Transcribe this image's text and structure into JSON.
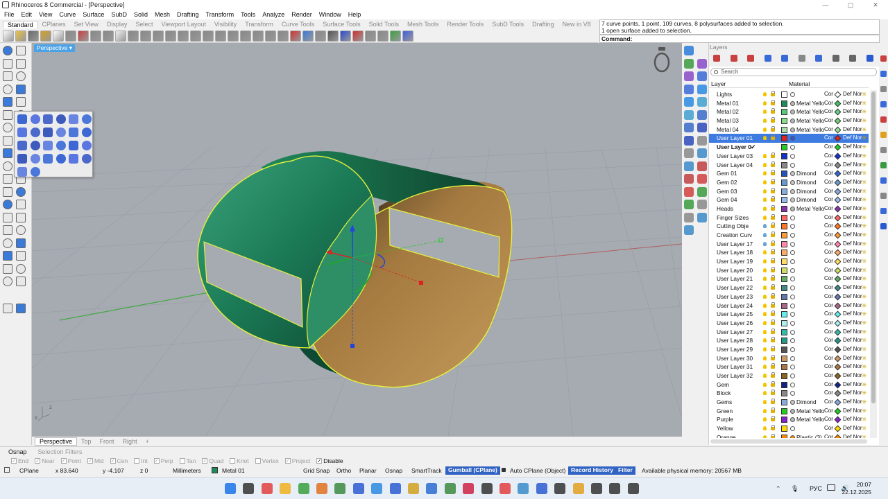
{
  "titlebar": {
    "title": "Rhinoceros 8 Commercial - [Perspective]",
    "min": "—",
    "max": "▢",
    "close": "✕"
  },
  "menu": [
    "File",
    "Edit",
    "View",
    "Curve",
    "Surface",
    "SubD",
    "Solid",
    "Mesh",
    "Drafting",
    "Transform",
    "Tools",
    "Analyze",
    "Render",
    "Window",
    "Help"
  ],
  "toolbar_tabs": [
    "Standard",
    "CPlanes",
    "Set View",
    "Display",
    "Select",
    "Viewport Layout",
    "Visibility",
    "Transform",
    "Curve Tools",
    "Surface Tools",
    "Solid Tools",
    "Mesh Tools",
    "Render Tools",
    "SubD Tools",
    "Drafting",
    "New in V8",
    "KeyShot"
  ],
  "command": {
    "history_line1": "7 curve points, 1 point, 109 curves, 8 polysurfaces added to selection.",
    "history_line2": "1 open surface added to selection.",
    "prompt": "Command:"
  },
  "viewport": {
    "title": "Perspective ▾",
    "axis_z": "z",
    "axis_x": "x"
  },
  "viewport_tabs": [
    "Perspective",
    "Top",
    "Front",
    "Right",
    "+"
  ],
  "panel": {
    "title": "Layers",
    "search_placeholder": "Search",
    "col_layer": "Layer",
    "col_material": "Material",
    "layers": [
      {
        "name": "Lights",
        "color": "#ffffff",
        "mat": "",
        "mc": "#ffffff",
        "dc": "#ffffff",
        "cur": false,
        "sel": false,
        "bulb": "on"
      },
      {
        "name": "Metal 01",
        "color": "#1e8c5a",
        "mat": "Metal Yello",
        "mc": "#b8b8b8",
        "dc": "#44c060",
        "cur": false,
        "sel": false,
        "bulb": "on"
      },
      {
        "name": "Metal 02",
        "color": "#5ac878",
        "mat": "Metal Yello",
        "mc": "#b8b8b8",
        "dc": "#66cc88",
        "cur": false,
        "sel": false,
        "bulb": "on"
      },
      {
        "name": "Metal 03",
        "color": "#88dd88",
        "mat": "Metal Yello",
        "mc": "#b8b8b8",
        "dc": "#77cc77",
        "cur": false,
        "sel": false,
        "bulb": "on"
      },
      {
        "name": "Metal 04",
        "color": "#aaddaa",
        "mat": "Metal Yello",
        "mc": "#b8b8b8",
        "dc": "#99dd99",
        "cur": false,
        "sel": false,
        "bulb": "on"
      },
      {
        "name": "User Layer 01",
        "color": "#dd2222",
        "mat": "",
        "mc": "#3355dd",
        "dc": "#dd2222",
        "cur": false,
        "sel": true,
        "bulb": "on"
      },
      {
        "name": "User Layer 0",
        "color": "#22cc22",
        "mat": "",
        "mc": "#ffffff",
        "dc": "#22cc22",
        "cur": true,
        "sel": false,
        "bulb": "on"
      },
      {
        "name": "User Layer 03",
        "color": "#1133cc",
        "mat": "",
        "mc": "#ffffff",
        "dc": "#1133cc",
        "cur": false,
        "sel": false,
        "bulb": "on"
      },
      {
        "name": "User Layer 04",
        "color": "#888888",
        "mat": "",
        "mc": "#ffffff",
        "dc": "#888888",
        "cur": false,
        "sel": false,
        "bulb": "on"
      },
      {
        "name": "Gem 01",
        "color": "#2255bb",
        "mat": "Dimond",
        "mc": "#c8c8c8",
        "dc": "#3366cc",
        "cur": false,
        "sel": false,
        "bulb": "on"
      },
      {
        "name": "Gem 02",
        "color": "#6699cc",
        "mat": "Dimond",
        "mc": "#c8c8c8",
        "dc": "#6699cc",
        "cur": false,
        "sel": false,
        "bulb": "on"
      },
      {
        "name": "Gem 03",
        "color": "#88aadd",
        "mat": "Dimond",
        "mc": "#c8c8c8",
        "dc": "#88aadd",
        "cur": false,
        "sel": false,
        "bulb": "on"
      },
      {
        "name": "Gem 04",
        "color": "#99bbee",
        "mat": "Dimond",
        "mc": "#c8c8c8",
        "dc": "#99bbee",
        "cur": false,
        "sel": false,
        "bulb": "on"
      },
      {
        "name": "Heads",
        "color": "#8833aa",
        "mat": "Metal Yello",
        "mc": "#b8b8b8",
        "dc": "#8833aa",
        "cur": false,
        "sel": false,
        "bulb": "on"
      },
      {
        "name": "Finger Sizes",
        "color": "#ff6666",
        "mat": "",
        "mc": "#ffffff",
        "dc": "#ff6666",
        "cur": false,
        "sel": false,
        "bulb": "on"
      },
      {
        "name": "Cutting Obje",
        "color": "#ff7722",
        "mat": "",
        "mc": "#ffffff",
        "dc": "#ff7722",
        "cur": false,
        "sel": false,
        "bulb": "off"
      },
      {
        "name": "Creation Curv",
        "color": "#ff9933",
        "mat": "",
        "mc": "#ffffff",
        "dc": "#ff9933",
        "cur": false,
        "sel": false,
        "bulb": "off"
      },
      {
        "name": "User Layer 17",
        "color": "#ff88aa",
        "mat": "",
        "mc": "#ffffff",
        "dc": "#ff88aa",
        "cur": false,
        "sel": false,
        "bulb": "off"
      },
      {
        "name": "User Layer 18",
        "color": "#ffaa66",
        "mat": "",
        "mc": "#ffffff",
        "dc": "#ffaa66",
        "cur": false,
        "sel": false,
        "bulb": "on"
      },
      {
        "name": "User Layer 19",
        "color": "#ffdd66",
        "mat": "",
        "mc": "#ffffff",
        "dc": "#ffdd66",
        "cur": false,
        "sel": false,
        "bulb": "on"
      },
      {
        "name": "User Layer 20",
        "color": "#ccdd66",
        "mat": "",
        "mc": "#ffffff",
        "dc": "#ccdd66",
        "cur": false,
        "sel": false,
        "bulb": "on"
      },
      {
        "name": "User Layer 21",
        "color": "#66aa66",
        "mat": "",
        "mc": "#ffffff",
        "dc": "#66aa66",
        "cur": false,
        "sel": false,
        "bulb": "on"
      },
      {
        "name": "User Layer 22",
        "color": "#448888",
        "mat": "",
        "mc": "#ffffff",
        "dc": "#448888",
        "cur": false,
        "sel": false,
        "bulb": "on"
      },
      {
        "name": "User Layer 23",
        "color": "#6677aa",
        "mat": "",
        "mc": "#ffffff",
        "dc": "#6677aa",
        "cur": false,
        "sel": false,
        "bulb": "on"
      },
      {
        "name": "User Layer 24",
        "color": "#aa6688",
        "mat": "",
        "mc": "#ffffff",
        "dc": "#aa6688",
        "cur": false,
        "sel": false,
        "bulb": "on"
      },
      {
        "name": "User Layer 25",
        "color": "#66eeee",
        "mat": "",
        "mc": "#ffffff",
        "dc": "#66eeee",
        "cur": false,
        "sel": false,
        "bulb": "on"
      },
      {
        "name": "User Layer 26",
        "color": "#aaeeee",
        "mat": "",
        "mc": "#ffffff",
        "dc": "#aaeeee",
        "cur": false,
        "sel": false,
        "bulb": "on"
      },
      {
        "name": "User Layer 27",
        "color": "#33bbaa",
        "mat": "",
        "mc": "#ffffff",
        "dc": "#33bbaa",
        "cur": false,
        "sel": false,
        "bulb": "on"
      },
      {
        "name": "User Layer 28",
        "color": "#229988",
        "mat": "",
        "mc": "#ffffff",
        "dc": "#229988",
        "cur": false,
        "sel": false,
        "bulb": "on"
      },
      {
        "name": "User Layer 29",
        "color": "#555555",
        "mat": "",
        "mc": "#ffffff",
        "dc": "#555555",
        "cur": false,
        "sel": false,
        "bulb": "on"
      },
      {
        "name": "User Layer 30",
        "color": "#cc9966",
        "mat": "",
        "mc": "#ffffff",
        "dc": "#cc9966",
        "cur": false,
        "sel": false,
        "bulb": "on"
      },
      {
        "name": "User Layer 31",
        "color": "#aa7744",
        "mat": "",
        "mc": "#ffffff",
        "dc": "#aa7744",
        "cur": false,
        "sel": false,
        "bulb": "on"
      },
      {
        "name": "User Layer 32",
        "color": "#886622",
        "mat": "",
        "mc": "#ffffff",
        "dc": "#886622",
        "cur": false,
        "sel": false,
        "bulb": "on"
      },
      {
        "name": "Gem",
        "color": "#112288",
        "mat": "",
        "mc": "#ffffff",
        "dc": "#112288",
        "cur": false,
        "sel": false,
        "bulb": "on"
      },
      {
        "name": "Block",
        "color": "#888888",
        "mat": "",
        "mc": "#ffffff",
        "dc": "#888888",
        "cur": false,
        "sel": false,
        "bulb": "on"
      },
      {
        "name": "Gems",
        "color": "#88aadd",
        "mat": "Dimond",
        "mc": "#c8c8c8",
        "dc": "#88aadd",
        "cur": false,
        "sel": false,
        "bulb": "on"
      },
      {
        "name": "Green",
        "color": "#22cc22",
        "mat": "Metal Yello",
        "mc": "#b8b8b8",
        "dc": "#22cc22",
        "cur": false,
        "sel": false,
        "bulb": "on"
      },
      {
        "name": "Purple",
        "color": "#8822cc",
        "mat": "Metal Yello",
        "mc": "#b8b8b8",
        "dc": "#8822cc",
        "cur": false,
        "sel": false,
        "bulb": "on"
      },
      {
        "name": "Yellow",
        "color": "#ffdd00",
        "mat": "",
        "mc": "#ffffff",
        "dc": "#ffdd00",
        "cur": false,
        "sel": false,
        "bulb": "on"
      },
      {
        "name": "Orange",
        "color": "#ff8800",
        "mat": "Plastic (3)",
        "mc": "#ff8800",
        "dc": "#ff8800",
        "cur": false,
        "sel": false,
        "bulb": "on"
      }
    ],
    "cor_label": "Cor",
    "def_label": "Def Nor"
  },
  "osnap_tabs": [
    "Osnap",
    "Selection Filters"
  ],
  "osnaps": [
    {
      "label": "End",
      "on": true
    },
    {
      "label": "Near",
      "on": true
    },
    {
      "label": "Point",
      "on": true
    },
    {
      "label": "Mid",
      "on": true
    },
    {
      "label": "Cen",
      "on": true
    },
    {
      "label": "Int",
      "on": false
    },
    {
      "label": "Perp",
      "on": true
    },
    {
      "label": "Tan",
      "on": false
    },
    {
      "label": "Quad",
      "on": true
    },
    {
      "label": "Knot",
      "on": false
    },
    {
      "label": "Vertex",
      "on": false
    },
    {
      "label": "Project",
      "on": true
    },
    {
      "label": "Disable",
      "on": true,
      "active": true
    }
  ],
  "status": {
    "cplane": "CPlane",
    "x": "x 83.640",
    "y": "y -4.107",
    "z": "z 0",
    "units": "Millimeters",
    "layer": "Metal 01",
    "grid_snap": "Grid Snap",
    "ortho": "Ortho",
    "planar": "Planar",
    "osnap": "Osnap",
    "smarttrack": "SmartTrack",
    "gumball": "Gumball (CPlane)",
    "auto_cplane": "Auto CPlane (Object)",
    "record_history": "Record History",
    "filter": "Filter",
    "memory": "Available physical memory: 20567 MB"
  },
  "taskbar": {
    "time": "20:07",
    "date": "22.12.2025",
    "lang": "РУС"
  },
  "colors": {
    "selection_blue": "#3e7be0",
    "viewport_bg": "#a6aab1",
    "surface_green": "#1b7a56",
    "surface_gold": "#a97f45",
    "highlight_yellow": "#e6f23c"
  }
}
